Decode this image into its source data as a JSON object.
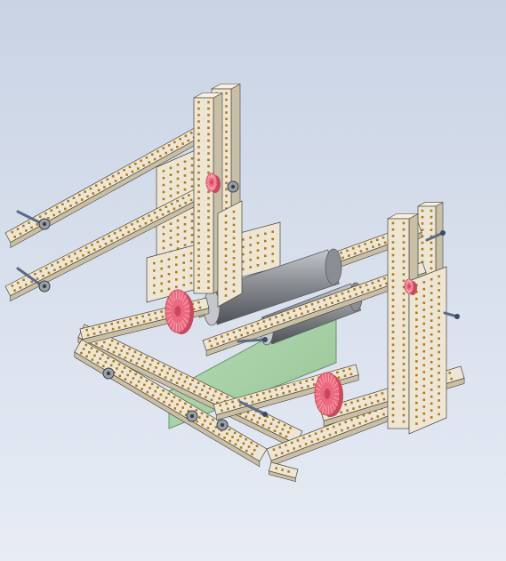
{
  "viewport": {
    "name": "3d-cad-viewport",
    "background_top": "#c9d3e4",
    "background_bottom": "#e7ecf5"
  },
  "colors": {
    "beam_face": "#ede6d4",
    "beam_side": "#c9bfa6",
    "beam_edge": "#4a4438",
    "hole": "#b07a1e",
    "gear": "#ec6a7f",
    "gear_dark": "#c8485e",
    "motor": "#8a8d92",
    "motor_light": "#c4c7cc",
    "motor_dark": "#5a5d62",
    "plate": "#9ccd9a",
    "axle": "#5b6a86"
  },
  "model": {
    "parts": [
      "left-tower",
      "right-tower",
      "upper-rail-front",
      "upper-rail-back",
      "center-crossbar",
      "front-frame",
      "drive-motors",
      "green-plate",
      "gears"
    ]
  }
}
